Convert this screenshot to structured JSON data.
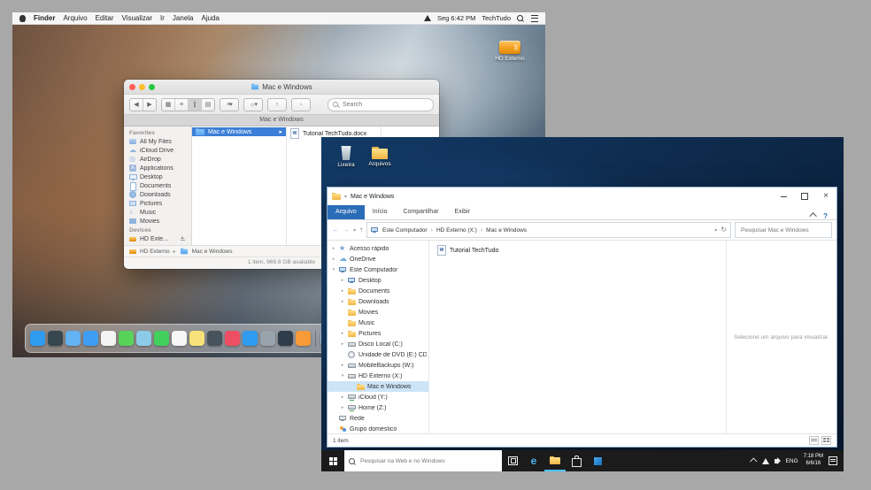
{
  "colors": {
    "mac_selection_blue": "#3b7fd8",
    "win_file_tab_blue": "#2b6cb8",
    "win_taskbar_dark": "#1b1b1b",
    "mac_drive_orange": "#f49f1c"
  },
  "mac": {
    "menubar": {
      "menus": [
        {
          "label": "Finder",
          "state": "bold"
        },
        {
          "label": "Arquivo"
        },
        {
          "label": "Editar"
        },
        {
          "label": "Visualizar"
        },
        {
          "label": "Ir"
        },
        {
          "label": "Janela"
        },
        {
          "label": "Ajuda"
        }
      ],
      "clock": "Seg 6:42 PM",
      "username": "TechTudo"
    },
    "desktop": {
      "drive_label": "HD Externo"
    },
    "finder": {
      "window_title": "Mac e Windows",
      "tab_title": "Mac e Windows",
      "toolbar": {
        "search_placeholder": "Search"
      },
      "sidebar": {
        "favorites_header": "Favorites",
        "favorites": [
          {
            "label": "All My Files",
            "icon": "allfiles"
          },
          {
            "label": "iCloud Drive",
            "icon": "cloud"
          },
          {
            "label": "AirDrop",
            "icon": "airdrop"
          },
          {
            "label": "Applications",
            "icon": "apps"
          },
          {
            "label": "Desktop",
            "icon": "desktop"
          },
          {
            "label": "Documents",
            "icon": "docs"
          },
          {
            "label": "Downloads",
            "icon": "downloads"
          },
          {
            "label": "Pictures",
            "icon": "pictures"
          },
          {
            "label": "Music",
            "icon": "music"
          },
          {
            "label": "Movies",
            "icon": "movies"
          }
        ],
        "devices_header": "Devices",
        "devices": [
          {
            "label": "HD Exte...",
            "icon": "drive"
          }
        ]
      },
      "columns": {
        "selected_folder": "Mac e Windows",
        "file": "Tutorial TechTudo.docx"
      },
      "pathbar": {
        "device": "HD Externo",
        "folder": "Mac e Windows"
      },
      "status": "1 item, 969.8 GB available"
    },
    "dock_apps": [
      {
        "name": "finder-dock-icon",
        "color": "#2f9bef"
      },
      {
        "name": "launchpad-dock-icon",
        "color": "#37474f"
      },
      {
        "name": "mail-dock-icon",
        "color": "#63b2f2"
      },
      {
        "name": "safari-dock-icon",
        "color": "#3f9ef3"
      },
      {
        "name": "photos-dock-icon",
        "color": "#f4f4f4"
      },
      {
        "name": "messages-dock-icon",
        "color": "#58d35a"
      },
      {
        "name": "maps-dock-icon",
        "color": "#8ccbe8"
      },
      {
        "name": "facetime-dock-icon",
        "color": "#43cf5c"
      },
      {
        "name": "calendar-dock-icon",
        "color": "#f7f7f7"
      },
      {
        "name": "notes-dock-icon",
        "color": "#f6e278"
      },
      {
        "name": "photo-booth-dock-icon",
        "color": "#46525c"
      },
      {
        "name": "itunes-dock-icon",
        "color": "#ee4f63"
      },
      {
        "name": "app-store-dock-icon",
        "color": "#2e9bf0"
      },
      {
        "name": "system-preferences-dock-icon",
        "color": "#98a3ab"
      },
      {
        "name": "terminal-dock-icon",
        "color": "#2f3d4a"
      },
      {
        "name": "ibooks-dock-icon",
        "color": "#f79a37"
      }
    ],
    "dock_right": [
      {
        "name": "downloads-stack-dock-icon",
        "color": "#9fb6c6"
      },
      {
        "name": "trash-dock-icon",
        "color": "#d9dfe4"
      }
    ]
  },
  "windows": {
    "desktop_icons": [
      {
        "label": "Lixeira",
        "icon": "recycle-bin"
      },
      {
        "label": "Arquivos",
        "icon": "folder"
      }
    ],
    "explorer": {
      "window_title": "Mac e Windows",
      "ribbon_tabs": [
        {
          "label": "Arquivo",
          "state": "file-tab"
        },
        {
          "label": "Início"
        },
        {
          "label": "Compartilhar"
        },
        {
          "label": "Exibir"
        }
      ],
      "breadcrumb": [
        {
          "label": "Este Computador"
        },
        {
          "label": "HD Externo (X:)"
        },
        {
          "label": "Mac e Windows"
        }
      ],
      "search_placeholder": "Pesquisar Mac e Windows",
      "sidebar": [
        {
          "label": "Acesso rápido",
          "icon": "star",
          "chev": "▸",
          "indent": 0
        },
        {
          "label": "OneDrive",
          "icon": "cloud",
          "chev": "▸",
          "indent": 0
        },
        {
          "label": "Este Computador",
          "icon": "pc",
          "chev": "▾",
          "indent": 0
        },
        {
          "label": "Desktop",
          "icon": "pc",
          "chev": "▸",
          "indent": 1
        },
        {
          "label": "Documents",
          "icon": "folder",
          "chev": "▸",
          "indent": 1
        },
        {
          "label": "Downloads",
          "icon": "folder",
          "chev": "▸",
          "indent": 1
        },
        {
          "label": "Movies",
          "icon": "folder",
          "indent": 1
        },
        {
          "label": "Music",
          "icon": "folder",
          "indent": 1
        },
        {
          "label": "Pictures",
          "icon": "folder",
          "chev": "▸",
          "indent": 1
        },
        {
          "label": "Disco Local (C:)",
          "icon": "drive",
          "chev": "▸",
          "indent": 1
        },
        {
          "label": "Unidade de DVD (E:) CDROM",
          "icon": "dvd",
          "indent": 1
        },
        {
          "label": "MobileBackups (W:)",
          "icon": "drive",
          "chev": "▸",
          "indent": 1
        },
        {
          "label": "HD Externo (X:)",
          "icon": "drive",
          "chev": "▾",
          "indent": 1
        },
        {
          "label": "Mac e Windows",
          "icon": "folder",
          "indent": 2,
          "state": "selected"
        },
        {
          "label": "iCloud (Y:)",
          "icon": "netdrive",
          "chev": "▸",
          "indent": 1
        },
        {
          "label": "Home (Z:)",
          "icon": "netdrive",
          "chev": "▸",
          "indent": 1
        },
        {
          "label": "Rede",
          "icon": "net",
          "indent": 0
        },
        {
          "label": "Grupo doméstico",
          "icon": "home",
          "indent": 0
        }
      ],
      "file": {
        "name": "Tutorial TechTudo"
      },
      "preview_text": "Selecione um arquivo para visualizar.",
      "status": "1 item"
    },
    "taskbar": {
      "search_placeholder": "Pesquisar na Web e no Windows",
      "apps": [
        {
          "name": "task-view-icon",
          "glyph": "tv"
        },
        {
          "name": "edge-icon",
          "glyph": "e"
        },
        {
          "name": "file-explorer-icon",
          "glyph": "folder",
          "state": "open"
        },
        {
          "name": "store-icon",
          "glyph": "bag"
        },
        {
          "name": "photos-icon",
          "glyph": "photos"
        }
      ],
      "tray": {
        "lang": "ENG",
        "time": "7:18 PM",
        "date": "6/6/16"
      }
    }
  }
}
